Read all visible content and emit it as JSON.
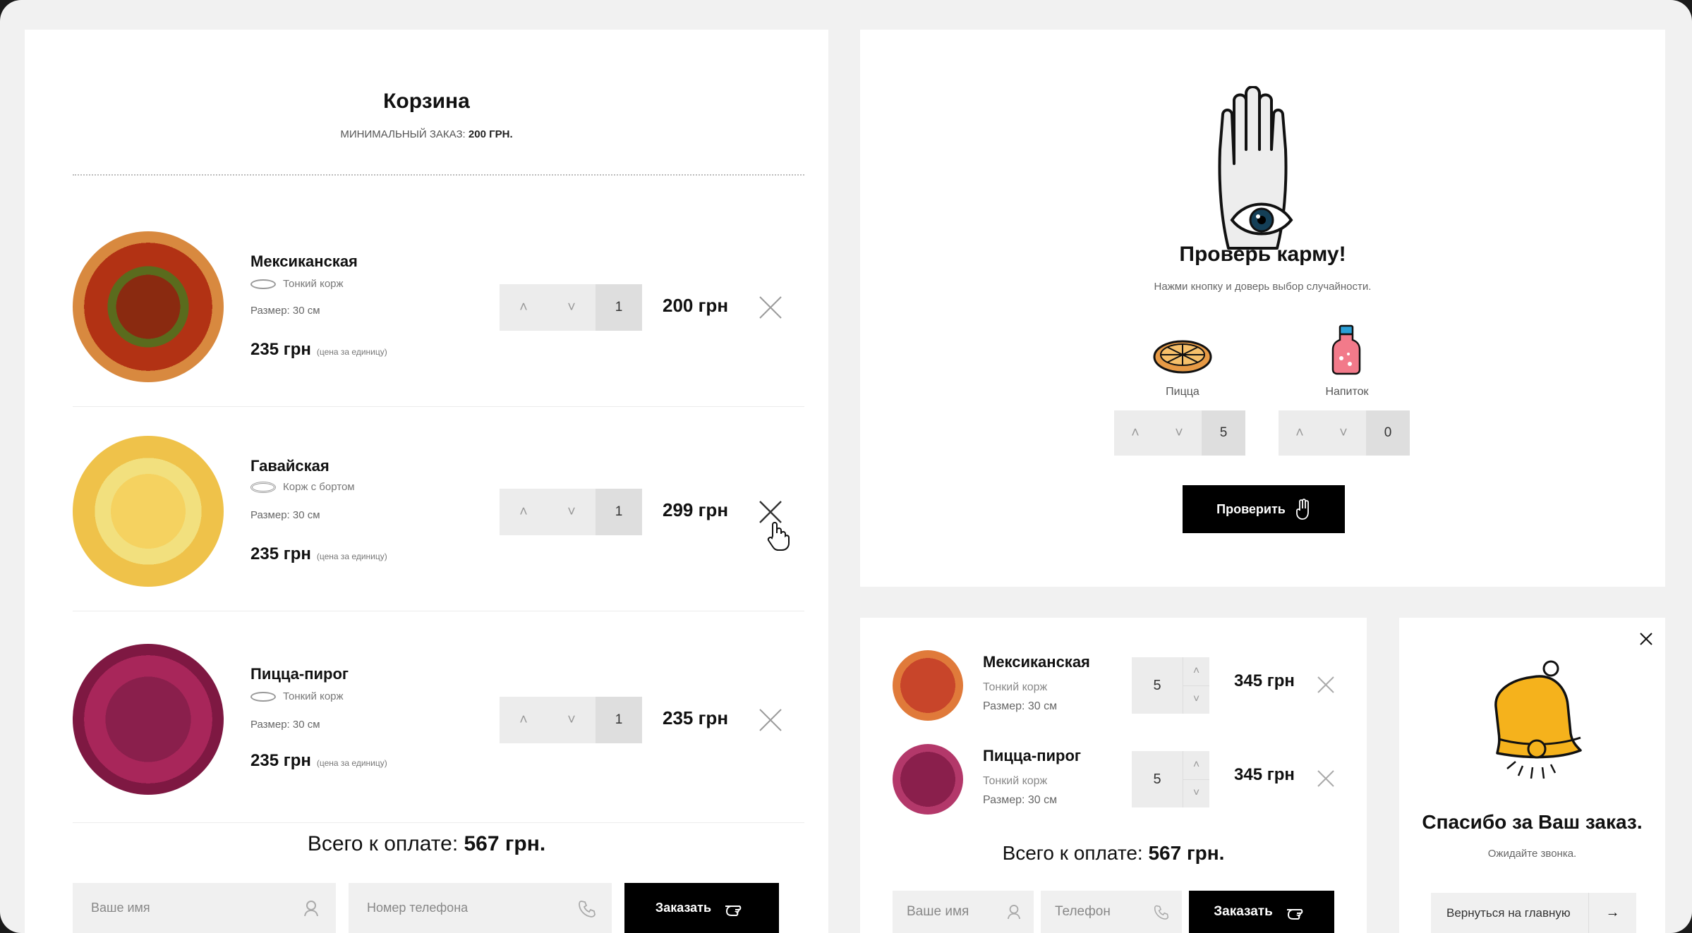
{
  "cart": {
    "title": "Корзина",
    "min_order_label": "МИНИМАЛЬНЫЙ ЗАКАЗ:",
    "min_order_value": "200 ГРН.",
    "items": [
      {
        "name": "Мексиканская",
        "crust": "Тонкий корж",
        "size": "Размер: 30 см",
        "unit_price": "235 грн",
        "unit_note": "(цена за единицу)",
        "qty": "1",
        "total": "200 грн"
      },
      {
        "name": "Гавайская",
        "crust": "Корж с бортом",
        "size": "Размер: 30 см",
        "unit_price": "235 грн",
        "unit_note": "(цена за единицу)",
        "qty": "1",
        "total": "299 грн"
      },
      {
        "name": "Пицца-пирог",
        "crust": "Тонкий корж",
        "size": "Размер: 30 см",
        "unit_price": "235 грн",
        "unit_note": "(цена за единицу)",
        "qty": "1",
        "total": "235 грн"
      }
    ],
    "total_label": "Всего к оплате:",
    "total_value": "567 грн.",
    "name_placeholder": "Ваше имя",
    "phone_placeholder": "Номер телефона",
    "order_button": "Заказать"
  },
  "karma": {
    "title": "Проверь карму!",
    "subtitle": "Нажми кнопку и доверь выбор случайности.",
    "pizza_label": "Пицца",
    "pizza_qty": "5",
    "drink_label": "Напиток",
    "drink_qty": "0",
    "check_button": "Проверить"
  },
  "mini_cart": {
    "items": [
      {
        "name": "Мексиканская",
        "crust": "Тонкий корж",
        "size": "Размер: 30 см",
        "qty": "5",
        "total": "345 грн"
      },
      {
        "name": "Пицца-пирог",
        "crust": "Тонкий корж",
        "size": "Размер: 30 см",
        "qty": "5",
        "total": "345 грн"
      }
    ],
    "total_label": "Всего к оплате:",
    "total_value": "567 грн.",
    "name_placeholder": "Ваше имя",
    "phone_placeholder": "Телефон",
    "order_button": "Заказать"
  },
  "thanks": {
    "title": "Спасибо за Ваш заказ.",
    "subtitle": "Ожидайте звонка.",
    "back_button": "Вернуться на главную",
    "arrow": "→"
  },
  "colors": {
    "accent": "#000000",
    "stepper_bg": "#ececec",
    "bell": "#f5b21c"
  }
}
